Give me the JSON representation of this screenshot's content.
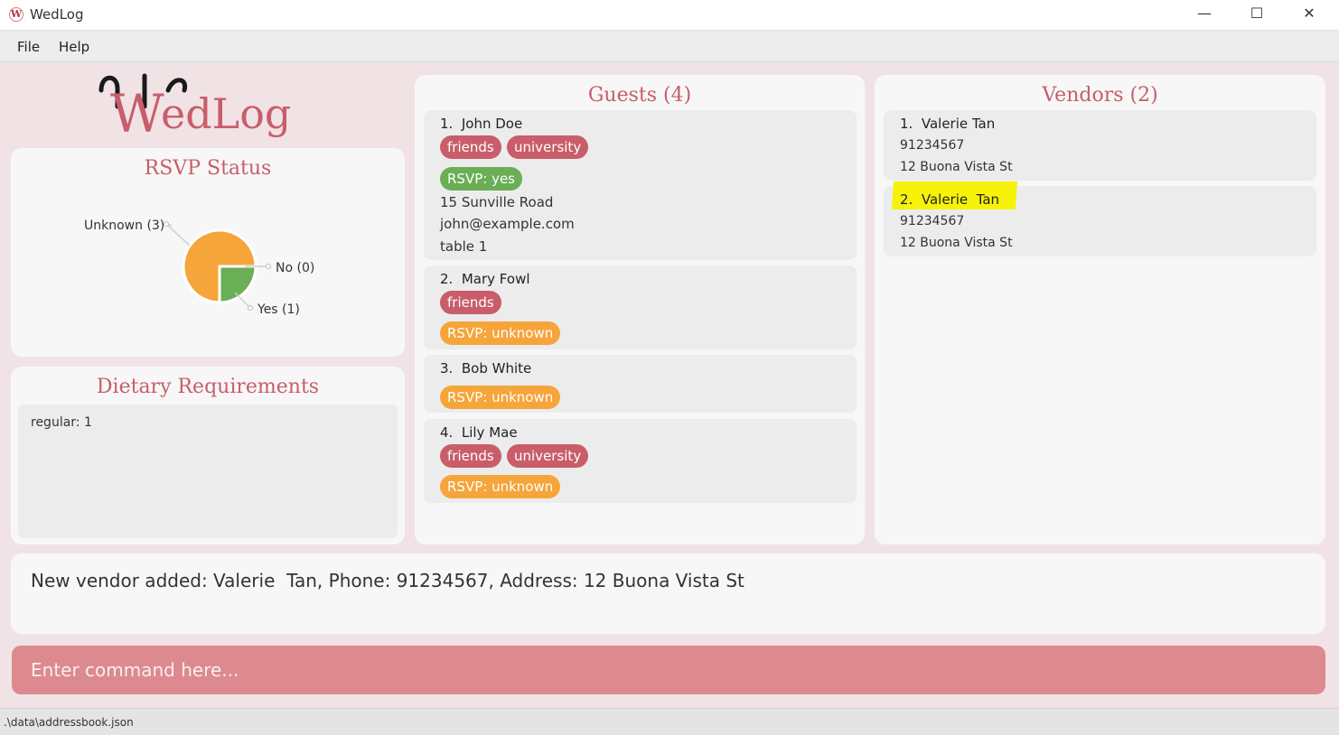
{
  "window": {
    "title": "WedLog",
    "icon": "wedlog-app-icon",
    "icon_glyph": "W",
    "minimize": "—",
    "maximize": "☐",
    "close": "✕"
  },
  "menu": {
    "file": "File",
    "help": "Help"
  },
  "logo": {
    "text_big": "W",
    "text_rest": "edLog"
  },
  "rsvp": {
    "title": "RSVP Status",
    "labels": {
      "unknown": "Unknown (3)",
      "no": "No (0)",
      "yes": "Yes (1)"
    }
  },
  "chart_data": {
    "type": "pie",
    "title": "RSVP Status",
    "slices": [
      {
        "label": "Unknown (3)",
        "value": 3,
        "color": "#f5a53a"
      },
      {
        "label": "No (0)",
        "value": 0,
        "color": "#c95d6a"
      },
      {
        "label": "Yes (1)",
        "value": 1,
        "color": "#6aae55"
      }
    ]
  },
  "dietary": {
    "title": "Dietary Requirements",
    "items": [
      "regular: 1"
    ]
  },
  "guests": {
    "title": "Guests (4)",
    "list": [
      {
        "index": "1.",
        "name": "John Doe",
        "tags": [
          "friends",
          "university"
        ],
        "rsvp": "RSVP: yes",
        "address": "15 Sunville Road",
        "email": "john@example.com",
        "table": "table 1"
      },
      {
        "index": "2.",
        "name": "Mary Fowl",
        "tags": [
          "friends"
        ],
        "rsvp": "RSVP: unknown"
      },
      {
        "index": "3.",
        "name": "Bob White",
        "tags": [],
        "rsvp": "RSVP: unknown"
      },
      {
        "index": "4.",
        "name": "Lily Mae",
        "tags": [
          "friends",
          "university"
        ],
        "rsvp": "RSVP: unknown"
      }
    ]
  },
  "vendors": {
    "title": "Vendors (2)",
    "list": [
      {
        "index": "1.",
        "name": "Valerie Tan",
        "phone": "91234567",
        "address": "12 Buona Vista St"
      },
      {
        "index": "2.",
        "name": "Valerie  Tan",
        "phone": "91234567",
        "address": "12 Buona Vista St"
      }
    ]
  },
  "result": {
    "message": "New vendor added: Valerie  Tan, Phone: 91234567, Address: 12 Buona Vista St"
  },
  "command": {
    "placeholder": "Enter command here...",
    "value": ""
  },
  "status": {
    "file_path": ".\\data\\addressbook.json"
  },
  "colors": {
    "accent": "#c95d6a",
    "rsvp_yes": "#6aae55",
    "rsvp_unknown": "#f5a53a",
    "command_bg": "#dc8a8f",
    "highlight": "#f6f20a"
  }
}
